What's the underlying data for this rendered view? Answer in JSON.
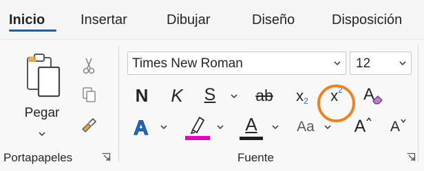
{
  "tabs": [
    {
      "label": "Inicio",
      "active": true
    },
    {
      "label": "Insertar",
      "active": false
    },
    {
      "label": "Dibujar",
      "active": false
    },
    {
      "label": "Diseño",
      "active": false
    },
    {
      "label": "Disposición",
      "active": false
    }
  ],
  "clipboard": {
    "paste_label": "Pegar",
    "group_label": "Portapapeles",
    "icons": [
      "paste-icon",
      "cut-icon",
      "copy-icon",
      "format-painter-icon"
    ]
  },
  "font": {
    "group_label": "Fuente",
    "font_name": "Times New Roman",
    "font_size": "12",
    "bold_label": "N",
    "italic_label": "K",
    "underline_label": "S",
    "strike_label": "ab",
    "subscript_base": "x",
    "subscript_mark": "2",
    "superscript_base": "x",
    "superscript_mark": "2",
    "change_case_label": "Aa",
    "grow_label": "A",
    "shrink_label": "A",
    "font_color_label": "A",
    "highlight_color": "#e600c8",
    "font_color": "#1e1e1e",
    "text_effects_color": "#1a6fd6",
    "callout_color": "#f0821e"
  }
}
